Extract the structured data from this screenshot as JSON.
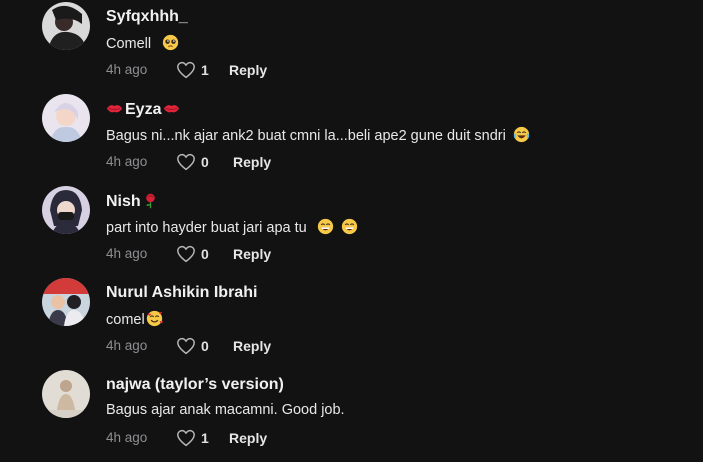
{
  "comments": [
    {
      "username": "Syfqxhhh_",
      "text": "Comell",
      "emoji": "pleading-face-emoji",
      "time": "4h ago",
      "likes": "1",
      "reply_label": "Reply"
    },
    {
      "username": "Eyza",
      "username_decor": "red-lips-emoji",
      "text": "Bagus ni...nk ajar ank2 buat cmni la...beli ape2 gune duit sndri",
      "emoji": "tears-of-joy-emoji",
      "time": "4h ago",
      "likes": "0",
      "reply_label": "Reply"
    },
    {
      "username": "Nish",
      "username_decor": "rose-emoji",
      "text": "part into hayder buat jari apa tu",
      "emoji": "grinning-sweat-emoji",
      "time": "4h ago",
      "likes": "0",
      "reply_label": "Reply"
    },
    {
      "username": "Nurul Ashikin Ibrahi",
      "text": "comel",
      "emoji": "smiling-hearts-emoji",
      "time": "4h ago",
      "likes": "0",
      "reply_label": "Reply"
    },
    {
      "username": "najwa (taylor’s version)",
      "text": "Bagus ajar anak macamni. Good job.",
      "time": "4h ago",
      "likes": "1",
      "reply_label": "Reply"
    }
  ],
  "colors": {
    "background": "#121212",
    "text": "#ffffff",
    "muted": "#8e8e93"
  }
}
